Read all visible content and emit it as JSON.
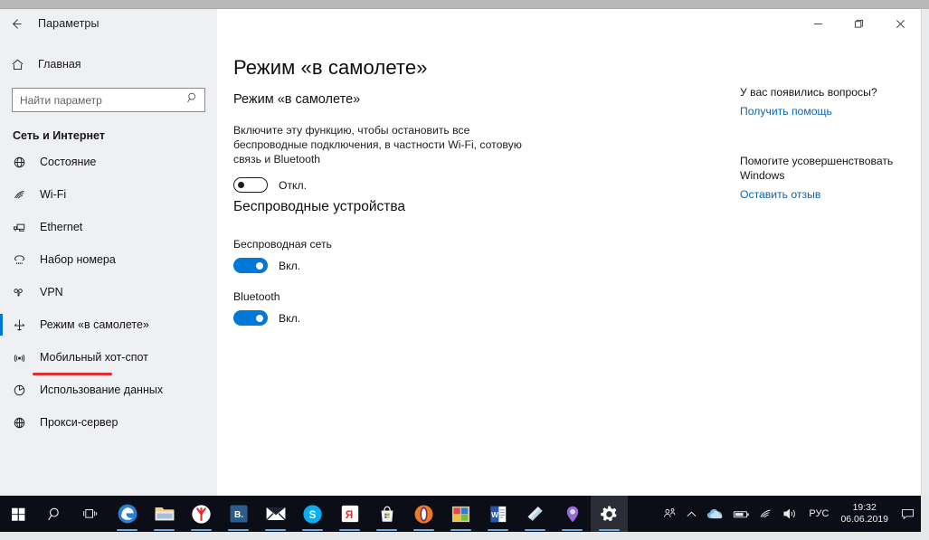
{
  "window": {
    "title": "Параметры",
    "back_icon": "back-arrow-icon",
    "controls": {
      "minimize": "minimize-icon",
      "maximize": "maximize-icon",
      "close": "close-icon"
    }
  },
  "sidebar": {
    "home_label": "Главная",
    "home_icon": "home-icon",
    "search": {
      "placeholder": "Найти параметр",
      "value": "",
      "icon": "search-icon"
    },
    "group_title": "Сеть и Интернет",
    "items": [
      {
        "label": "Состояние",
        "icon": "globe-status-icon",
        "selected": false
      },
      {
        "label": "Wi-Fi",
        "icon": "wifi-icon",
        "selected": false
      },
      {
        "label": "Ethernet",
        "icon": "ethernet-icon",
        "selected": false
      },
      {
        "label": "Набор номера",
        "icon": "dial-up-icon",
        "selected": false
      },
      {
        "label": "VPN",
        "icon": "vpn-key-icon",
        "selected": false
      },
      {
        "label": "Режим «в самолете»",
        "icon": "airplane-icon",
        "selected": true
      },
      {
        "label": "Мобильный хот-спот",
        "icon": "hotspot-icon",
        "selected": false
      },
      {
        "label": "Использование данных",
        "icon": "data-usage-icon",
        "selected": false
      },
      {
        "label": "Прокси-сервер",
        "icon": "proxy-globe-icon",
        "selected": false
      }
    ]
  },
  "main": {
    "page_title": "Режим «в самолете»",
    "airplane_section": {
      "heading": "Режим «в самолете»",
      "description": "Включите эту функцию, чтобы остановить все беспроводные подключения, в частности Wi-Fi, сотовую связь и Bluetooth",
      "toggle_state": "Откл.",
      "toggle_on": false
    },
    "wireless_section": {
      "heading": "Беспроводные устройства",
      "devices": [
        {
          "label": "Беспроводная сеть",
          "state": "Вкл.",
          "on": true
        },
        {
          "label": "Bluetooth",
          "state": "Вкл.",
          "on": true
        }
      ]
    }
  },
  "help_panel": {
    "question_title": "У вас появились вопросы?",
    "question_link": "Получить помощь",
    "feedback_title": "Помогите усовершенствовать Windows",
    "feedback_link": "Оставить отзыв"
  },
  "taskbar": {
    "start_icon": "windows-start-icon",
    "search_icon": "taskbar-search-icon",
    "taskview_icon": "task-view-icon",
    "apps": [
      {
        "name": "edge-icon",
        "label": "e"
      },
      {
        "name": "file-explorer-icon",
        "label": ""
      },
      {
        "name": "yandex-browser-icon",
        "label": "Y"
      },
      {
        "name": "vk-icon",
        "label": "B."
      },
      {
        "name": "mail-icon",
        "label": ""
      },
      {
        "name": "skype-icon",
        "label": "S"
      },
      {
        "name": "yandex-icon",
        "label": "Я"
      },
      {
        "name": "microsoft-store-icon",
        "label": ""
      },
      {
        "name": "opera-icon",
        "label": ""
      },
      {
        "name": "photos-icon",
        "label": ""
      },
      {
        "name": "word-icon",
        "label": "W"
      },
      {
        "name": "onenote-icon",
        "label": ""
      },
      {
        "name": "maps-icon",
        "label": ""
      },
      {
        "name": "settings-gear-icon",
        "label": ""
      }
    ],
    "tray": {
      "people_icon": "people-icon",
      "chevron_icon": "show-hidden-icons-icon",
      "onedrive_icon": "onedrive-icon",
      "battery_icon": "battery-icon",
      "network_icon": "wifi-tray-icon",
      "volume_icon": "volume-icon",
      "language": "РУС",
      "time": "19:32",
      "date": "06.06.2019",
      "action_center_icon": "action-center-icon"
    }
  },
  "colors": {
    "accent": "#0078d7",
    "link": "#0b65b5",
    "annotation": "#e03030",
    "sidebar_bg": "#eff0f3",
    "taskbar_bg": "#0b0d17"
  }
}
